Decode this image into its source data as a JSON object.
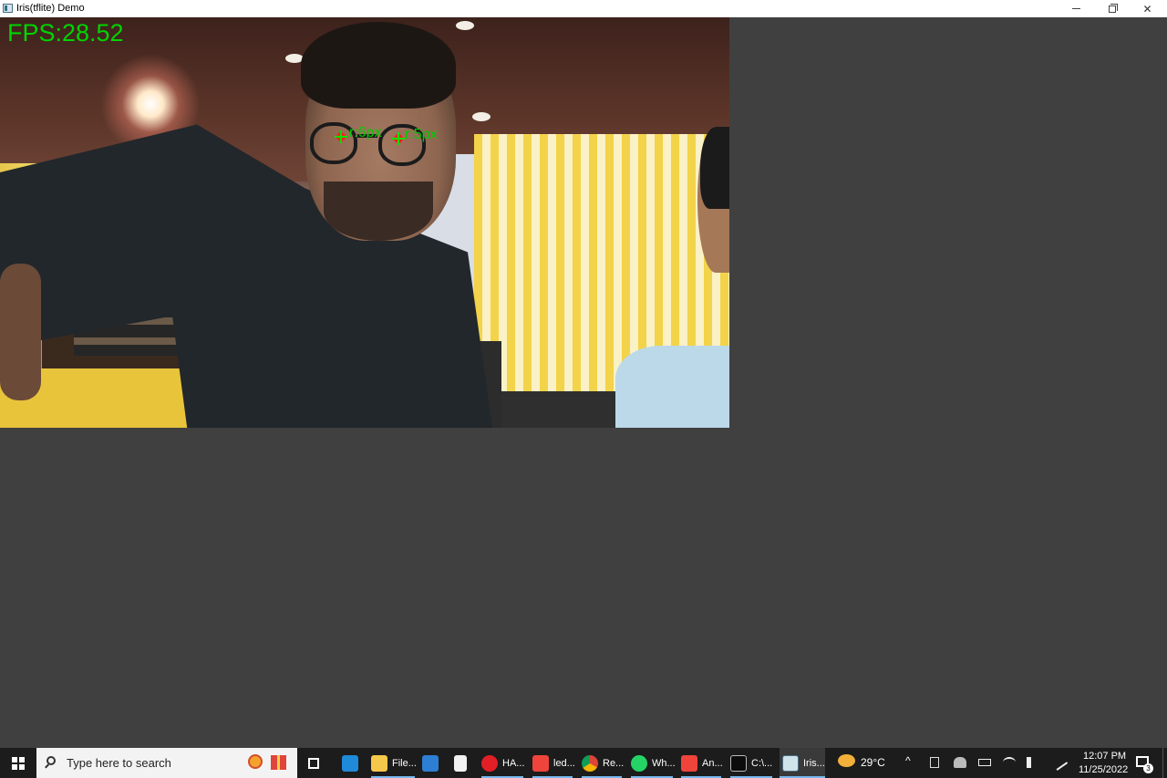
{
  "window": {
    "title": "Iris(tflite) Demo",
    "close_glyph": "✕"
  },
  "overlay": {
    "fps_text": "FPS:28.52",
    "left_radius_text": "r:6px",
    "right_radius_text": "r:5px",
    "text_color": "#00d400",
    "marker_color": "#ff2020"
  },
  "taskbar": {
    "search_placeholder": "Type here to search",
    "apps": [
      {
        "label": "",
        "icon": "microsoft-store-icon"
      },
      {
        "label": "File...",
        "icon": "file-explorer-icon"
      },
      {
        "label": "",
        "icon": "mail-icon"
      },
      {
        "label": "",
        "icon": "notepad-icon"
      },
      {
        "label": "HA...",
        "icon": "opera-icon"
      },
      {
        "label": "led...",
        "icon": "anydesk-icon"
      },
      {
        "label": "Re...",
        "icon": "chrome-icon"
      },
      {
        "label": "Wh...",
        "icon": "whatsapp-icon"
      },
      {
        "label": "An...",
        "icon": "anydesk-icon"
      },
      {
        "label": "C:\\...",
        "icon": "command-prompt-icon"
      },
      {
        "label": "Iris...",
        "icon": "iris-demo-icon"
      }
    ],
    "weather": "29°C",
    "tray_chevron": "^",
    "clock_time": "12:07 PM",
    "clock_date": "11/25/2022",
    "notification_count": "3"
  }
}
